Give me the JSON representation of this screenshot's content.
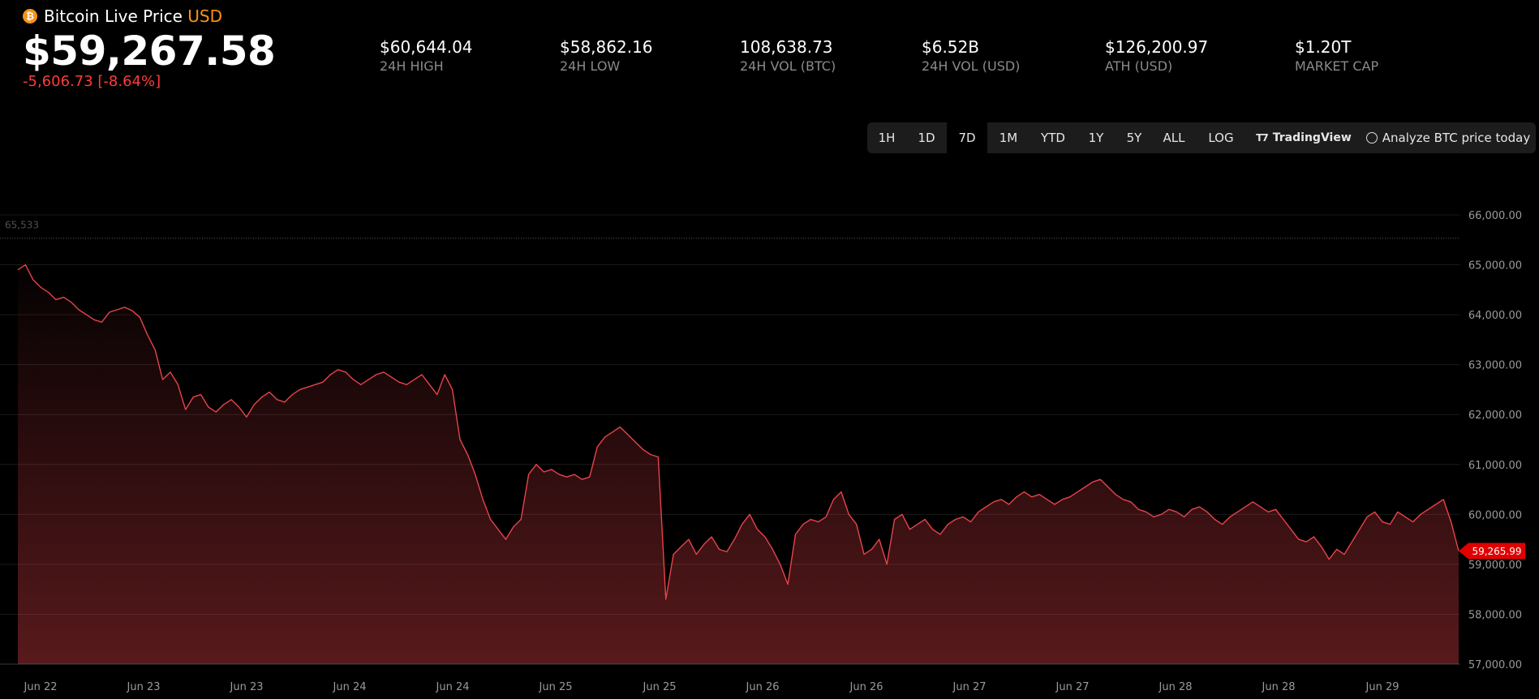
{
  "header": {
    "icon": "bitcoin-icon",
    "title": "Bitcoin Live Price",
    "currency": "USD",
    "price": "$59,267.58",
    "change": "-5,606.73 [-8.64%]"
  },
  "stats": [
    {
      "value": "$60,644.04",
      "label": "24H HIGH"
    },
    {
      "value": "$58,862.16",
      "label": "24H LOW"
    },
    {
      "value": "108,638.73",
      "label": "24H VOL (BTC)"
    },
    {
      "value": "$6.52B",
      "label": "24H VOL (USD)"
    },
    {
      "value": "$126,200.97",
      "label": "ATH (USD)"
    },
    {
      "value": "$1.20T",
      "label": "MARKET CAP"
    }
  ],
  "toolbar": {
    "ranges": [
      "1H",
      "1D",
      "7D",
      "1M",
      "YTD",
      "1Y",
      "5Y",
      "ALL",
      "LOG"
    ],
    "active_range": "7D",
    "tradingview_label": "TradingView",
    "analyze_label": "Analyze BTC price today"
  },
  "colors": {
    "accent_orange": "#f7931a",
    "negative_red": "#ff3b3b",
    "line_red": "#e8434a",
    "price_tag_red": "#e00000"
  },
  "chart_data": {
    "type": "area",
    "series": [
      {
        "values": [
          64900,
          65000,
          64700,
          64550,
          64450,
          64300,
          64350,
          64250,
          64100,
          64000,
          63900,
          63850,
          64050,
          64100,
          64150,
          64080,
          63950,
          63600,
          63300,
          62700,
          62850,
          62600,
          62100,
          62350,
          62400,
          62150,
          62050,
          62200,
          62300,
          62150,
          61950,
          62200,
          62350,
          62450,
          62300,
          62250,
          62400,
          62500,
          62550,
          62600,
          62650,
          62800,
          62900,
          62850,
          62700,
          62600,
          62700,
          62800,
          62850,
          62750,
          62650,
          62600,
          62700,
          62800,
          62600,
          62400,
          62800,
          62500,
          61500,
          61200,
          60800,
          60300,
          59900,
          59700,
          59500,
          59750,
          59900,
          60800,
          61000,
          60850,
          60900,
          60800,
          60750,
          60800,
          60700,
          60750,
          61350,
          61550,
          61650,
          61750,
          61600,
          61450,
          61300,
          61200,
          61150,
          58300,
          59200,
          59350,
          59500,
          59200,
          59400,
          59550,
          59300,
          59250,
          59500,
          59800,
          60000,
          59700,
          59550,
          59300,
          59000,
          58600,
          59600,
          59800,
          59900,
          59850,
          59950,
          60300,
          60450,
          60000,
          59800,
          59200,
          59300,
          59500,
          59000,
          59900,
          60000,
          59700,
          59800,
          59900,
          59700,
          59600,
          59800,
          59900,
          59950,
          59850,
          60050,
          60150,
          60250,
          60300,
          60200,
          60350,
          60450,
          60350,
          60400,
          60300,
          60200,
          60300,
          60350,
          60450,
          60550,
          60650,
          60700,
          60550,
          60400,
          60300,
          60250,
          60100,
          60050,
          59950,
          60000,
          60100,
          60050,
          59950,
          60100,
          60150,
          60050,
          59900,
          59800,
          59950,
          60050,
          60150,
          60250,
          60150,
          60050,
          60100,
          59900,
          59700,
          59500,
          59450,
          59550,
          59350,
          59100,
          59300,
          59200,
          59450,
          59700,
          59950,
          60050,
          59850,
          59800,
          60050,
          59950,
          59850,
          60000,
          60100,
          60200,
          60300,
          59850,
          59266
        ]
      }
    ],
    "x_tick_labels": [
      "Jun 22",
      "Jun 23",
      "Jun 23",
      "Jun 24",
      "Jun 24",
      "Jun 25",
      "Jun 25",
      "Jun 26",
      "Jun 26",
      "Jun 27",
      "Jun 27",
      "Jun 28",
      "Jun 28",
      "Jun 29"
    ],
    "y_ticks": [
      57000,
      58000,
      59000,
      60000,
      61000,
      62000,
      63000,
      64000,
      65000,
      66000
    ],
    "y_tick_labels": [
      "57,000.00",
      "58,000.00",
      "59,000.00",
      "60,000.00",
      "61,000.00",
      "62,000.00",
      "63,000.00",
      "64,000.00",
      "65,000.00",
      "66,000.00"
    ],
    "ylim": [
      57000,
      66000
    ],
    "reference_line": {
      "value": 65533,
      "label": "65,533"
    },
    "last_price_tag": {
      "value": 59265.99,
      "label": "59,265.99"
    },
    "grid": true
  }
}
